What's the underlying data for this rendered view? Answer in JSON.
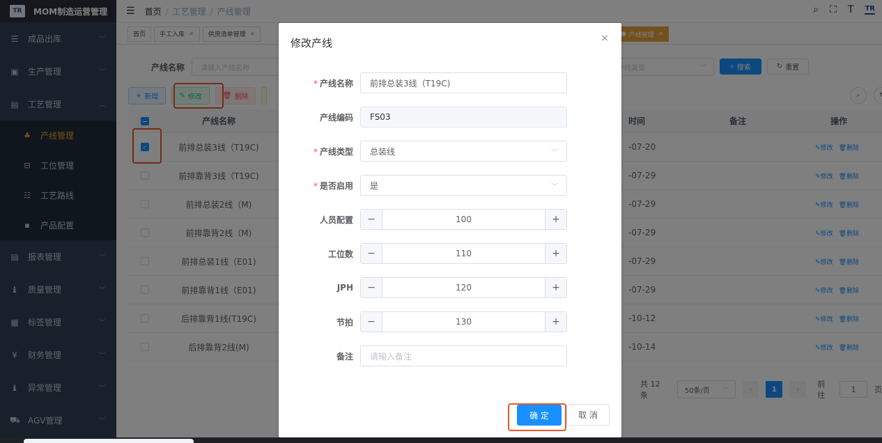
{
  "app": {
    "title": "MOM制造运营管理",
    "logo_text": "TR"
  },
  "sidebar": {
    "items": [
      {
        "label": "成品出库",
        "icon": "list-icon",
        "glyph": "☰",
        "expanded": false
      },
      {
        "label": "生产管理",
        "icon": "monitor-icon",
        "glyph": "▣",
        "expanded": false
      },
      {
        "label": "工艺管理",
        "icon": "grid-icon",
        "glyph": "▤",
        "expanded": true,
        "children": [
          {
            "label": "产线管理",
            "icon": "hierarchy-icon",
            "glyph": "♣",
            "active": true
          },
          {
            "label": "工位管理",
            "icon": "station-icon",
            "glyph": "⊟",
            "active": false
          },
          {
            "label": "工艺路线",
            "icon": "route-icon",
            "glyph": "☷",
            "active": false
          },
          {
            "label": "产品配置",
            "icon": "product-icon",
            "glyph": "▪",
            "active": false
          }
        ]
      },
      {
        "label": "报表管理",
        "icon": "report-icon",
        "glyph": "▤",
        "expanded": false
      },
      {
        "label": "质量管理",
        "icon": "quality-icon",
        "glyph": "♝",
        "expanded": false
      },
      {
        "label": "标签管理",
        "icon": "tag-icon",
        "glyph": "▦",
        "expanded": false
      },
      {
        "label": "财务管理",
        "icon": "yen-icon",
        "glyph": "¥",
        "expanded": false
      },
      {
        "label": "异常管理",
        "icon": "warning-icon",
        "glyph": "♝",
        "expanded": false
      },
      {
        "label": "AGV管理",
        "icon": "cart-icon",
        "glyph": "⛟",
        "expanded": false
      }
    ]
  },
  "header": {
    "breadcrumb": [
      "首页",
      "工艺管理",
      "产线管理"
    ],
    "brand_small": "TR"
  },
  "tags": [
    {
      "label": "首页",
      "closable": false
    },
    {
      "label": "手工入库",
      "closable": true
    },
    {
      "label": "供货清单管理",
      "closable": true
    }
  ],
  "active_tag": {
    "label": "产线管理"
  },
  "search": {
    "name_label": "产线名称",
    "name_placeholder": "请输入产线名称",
    "type_placeholder": "产线类型",
    "search_button": "搜索",
    "reset_button": "重置"
  },
  "actions": {
    "add": "新增",
    "edit": "修改",
    "delete": "删除"
  },
  "table": {
    "headers": {
      "name": "产线名称",
      "time": "时间",
      "remark": "备注",
      "ops": "操作"
    },
    "rows": [
      {
        "name": "前排总装3线（T19C)",
        "time": "-07-20",
        "checked": true
      },
      {
        "name": "前排靠背3线（T19C)",
        "time": "-07-29",
        "checked": false
      },
      {
        "name": "前排总装2线（M)",
        "time": "-07-29",
        "checked": false
      },
      {
        "name": "前排靠背2线（M)",
        "time": "-07-29",
        "checked": false
      },
      {
        "name": "前排总装1线（E01)",
        "time": "-07-29",
        "checked": false
      },
      {
        "name": "前排靠背1线（E01)",
        "time": "-07-29",
        "checked": false
      },
      {
        "name": "后排靠背1线(T19C)",
        "time": "-10-12",
        "checked": false
      },
      {
        "name": "后排靠背2线(M)",
        "time": "-10-14",
        "checked": false
      }
    ],
    "row_edit": "修改",
    "row_delete": "删除"
  },
  "pager": {
    "total": "共 12 条",
    "page_size": "50条/页",
    "current_page": "1",
    "goto_label": "前往",
    "goto_value": "1",
    "goto_suffix": "页"
  },
  "dialog": {
    "title": "修改产线",
    "fields": {
      "name": {
        "label": "产线名称",
        "value": "前排总装3线（T19C)",
        "required": true
      },
      "code": {
        "label": "产线编码",
        "value": "FS03",
        "required": false
      },
      "type": {
        "label": "产线类型",
        "value": "总装线",
        "required": true
      },
      "enabled": {
        "label": "是否启用",
        "value": "是",
        "required": true
      },
      "staff": {
        "label": "人员配置",
        "value": "100"
      },
      "stations": {
        "label": "工位数",
        "value": "110"
      },
      "jph": {
        "label": "JPH",
        "value": "120"
      },
      "takt": {
        "label": "节拍",
        "value": "130"
      },
      "remark": {
        "label": "备注",
        "placeholder": "请输入备注"
      }
    },
    "confirm_button": "确 定",
    "cancel_button": "取 消"
  },
  "colors": {
    "sidebar_bg": "#304156",
    "primary": "#1890ff",
    "active_menu": "#f0a020",
    "highlight_box": "#e8582a"
  }
}
